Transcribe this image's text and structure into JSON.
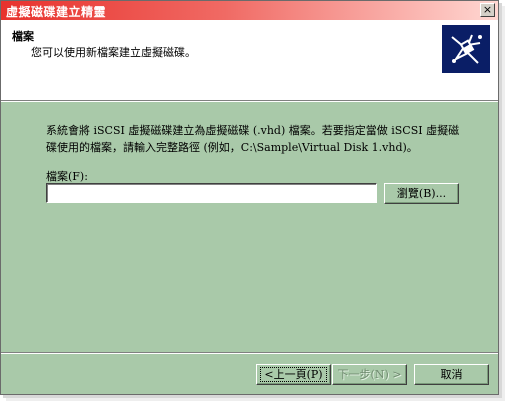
{
  "window": {
    "title": "虛擬磁碟建立精靈",
    "close_label": "×"
  },
  "header": {
    "title": "檔案",
    "subtitle": "您可以使用新檔案建立虛擬磁碟。",
    "icon": "wizard-icon"
  },
  "body": {
    "description": "系統會將 iSCSI 虛擬磁碟建立為虛擬磁碟 (.vhd) 檔案。若要指定當做 iSCSI 虛擬磁碟使用的檔案，請輸入完整路徑 (例如，C:\\Sample\\Virtual Disk 1.vhd)。",
    "file_label": "檔案(F):",
    "file_value": "",
    "browse_label": "瀏覽(B)..."
  },
  "footer": {
    "back_label": "<上一頁(P)",
    "next_label": "下一步(N) >",
    "cancel_label": "取消"
  },
  "colors": {
    "title_gradient_start": "#e8322d",
    "dialog_background": "#a9c9a9",
    "header_background": "#ffffff",
    "icon_background": "#0a1e66"
  }
}
